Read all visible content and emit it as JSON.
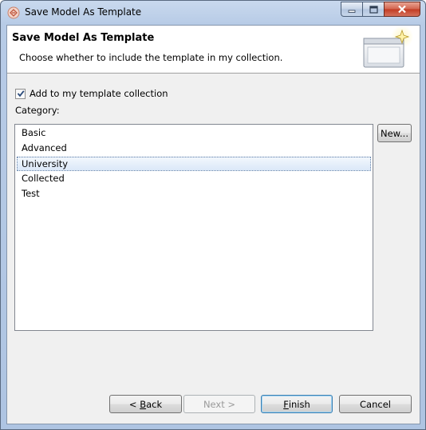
{
  "window": {
    "title": "Save Model As Template",
    "icons": {
      "app": "app-icon",
      "minimize": "minimize-icon",
      "maximize": "maximize-icon",
      "close": "close-icon"
    }
  },
  "banner": {
    "title": "Save Model As Template",
    "description": "Choose whether to include the template in my collection.",
    "image": "template-wizard-icon"
  },
  "add_to_collection": {
    "label": "Add to my template collection",
    "checked": true
  },
  "category": {
    "label": "Category:",
    "items": [
      "Basic",
      "Advanced",
      "University",
      "Collected",
      "Test"
    ],
    "selected": "University"
  },
  "buttons": {
    "new": "New...",
    "back": {
      "prefix": "< ",
      "mnemonic": "B",
      "rest": "ack"
    },
    "next": "Next >",
    "finish": {
      "mnemonic": "F",
      "rest": "inish"
    },
    "cancel": "Cancel"
  },
  "colors": {
    "selection": "#dbe8f8",
    "default_button_border": "#3c7fb1"
  }
}
